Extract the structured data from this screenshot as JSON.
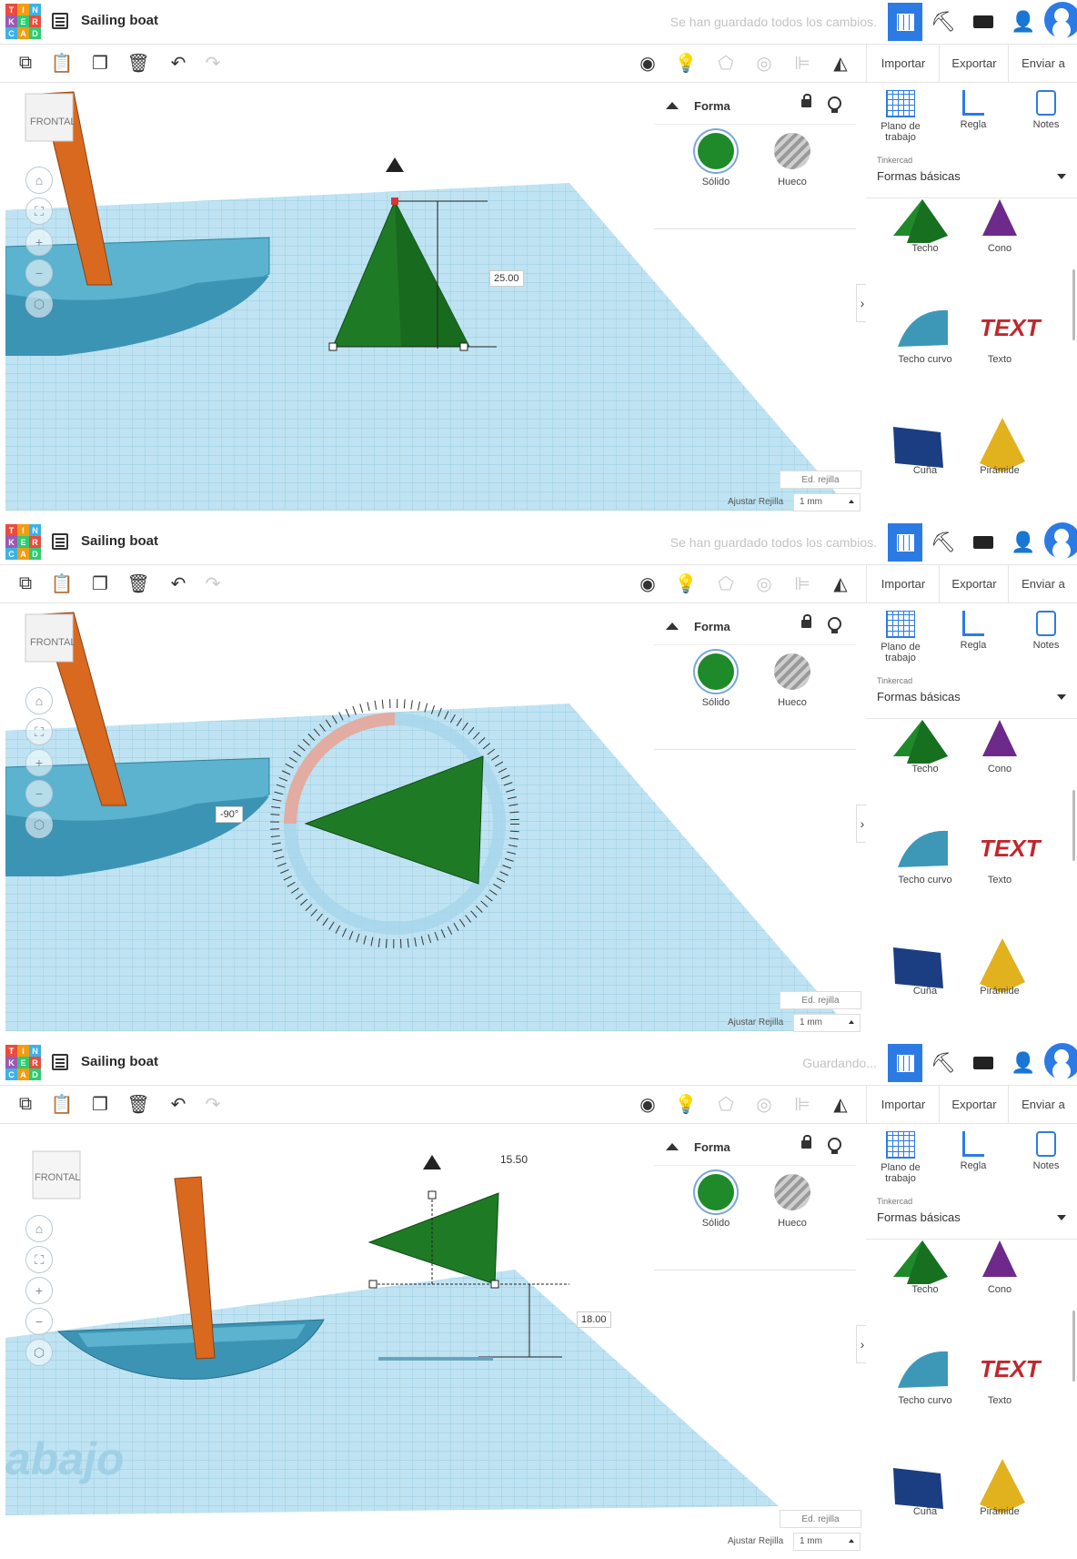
{
  "app": {
    "logo_letters": [
      "T",
      "I",
      "N",
      "K",
      "E",
      "R",
      "C",
      "A",
      "D"
    ],
    "logo_colors": [
      "#e84c3d",
      "#f39c12",
      "#3bb2e7",
      "#9b59b6",
      "#2ecc71",
      "#e84c3d",
      "#3bb2e7",
      "#f39c12",
      "#2ecc71"
    ],
    "title": "Sailing boat"
  },
  "toolbar": {
    "importar": "Importar",
    "exportar": "Exportar",
    "enviar": "Enviar a"
  },
  "panel": {
    "heading": "Forma",
    "solid_label": "Sólido",
    "hole_label": "Hueco"
  },
  "sidebar": {
    "workplane_label": "Plano de trabajo",
    "ruler_label": "Regla",
    "notes_label": "Notes",
    "library_small": "Tinkercad",
    "library_value": "Formas básicas",
    "shapes": [
      "Techo",
      "Cono",
      "Techo curvo",
      "Texto",
      "Cuña",
      "Pirámide"
    ]
  },
  "viewport": {
    "view_cube": "FRONTAL",
    "edit_grid": "Ed. rejilla",
    "snap_label": "Ajustar Rejilla",
    "snap_value": "1 mm"
  },
  "frames": [
    {
      "status": "Se han guardado todos los cambios.",
      "measure": "25.00"
    },
    {
      "status": "Se han guardado todos los cambios.",
      "angle": "-90°"
    },
    {
      "status": "Guardando...",
      "measure": "18.00",
      "top_value": "15.50",
      "workplane_text": "abajo"
    }
  ],
  "colors": {
    "accent": "#2c7be5",
    "shape_green": "#1f7a25",
    "boat": "#3d8fab",
    "mast": "#d2691e"
  }
}
